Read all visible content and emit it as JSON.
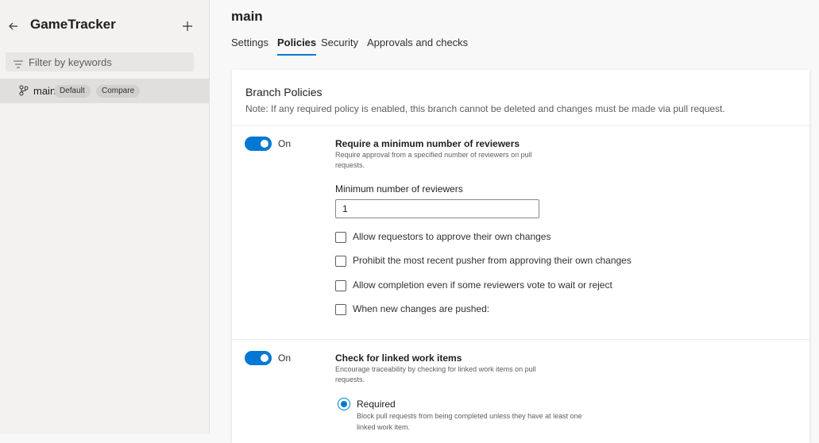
{
  "sidebar": {
    "app_title": "GameTracker",
    "filter_placeholder": "Filter by keywords",
    "branch": {
      "name": "main",
      "default_badge": "Default",
      "compare_label": "Compare"
    }
  },
  "main": {
    "title": "main",
    "tabs": [
      {
        "label": "Settings"
      },
      {
        "label": "Policies",
        "active": true
      },
      {
        "label": "Security"
      },
      {
        "label": "Approvals and checks"
      }
    ],
    "section": {
      "title": "Branch Policies",
      "note": "Note: If any required policy is enabled, this branch cannot be deleted and changes must be made via pull request."
    },
    "policies": [
      {
        "toggle_state": "On",
        "title": "Require a minimum number of reviewers",
        "description": "Require approval from a specified number of reviewers on pull requests.",
        "field_label": "Minimum number of reviewers",
        "field_value": "1",
        "options": [
          "Allow requestors to approve their own changes",
          "Prohibit the most recent pusher from approving their own changes",
          "Allow completion even if some reviewers vote to wait or reject",
          "When new changes are pushed:"
        ]
      },
      {
        "toggle_state": "On",
        "title": "Check for linked work items",
        "description": "Encourage traceability by checking for linked work items on pull requests.",
        "radio_label": "Required",
        "radio_description": "Block pull requests from being completed unless they have at least one linked work item."
      }
    ]
  },
  "colors": {
    "accent": "#0078d4",
    "sidebar_bg": "#f3f2f1",
    "selected_row": "#e1dfdd",
    "card_bg": "#ffffff"
  },
  "icons": [
    "back-arrow-icon",
    "plus-icon",
    "filter-icon",
    "branch-icon"
  ]
}
